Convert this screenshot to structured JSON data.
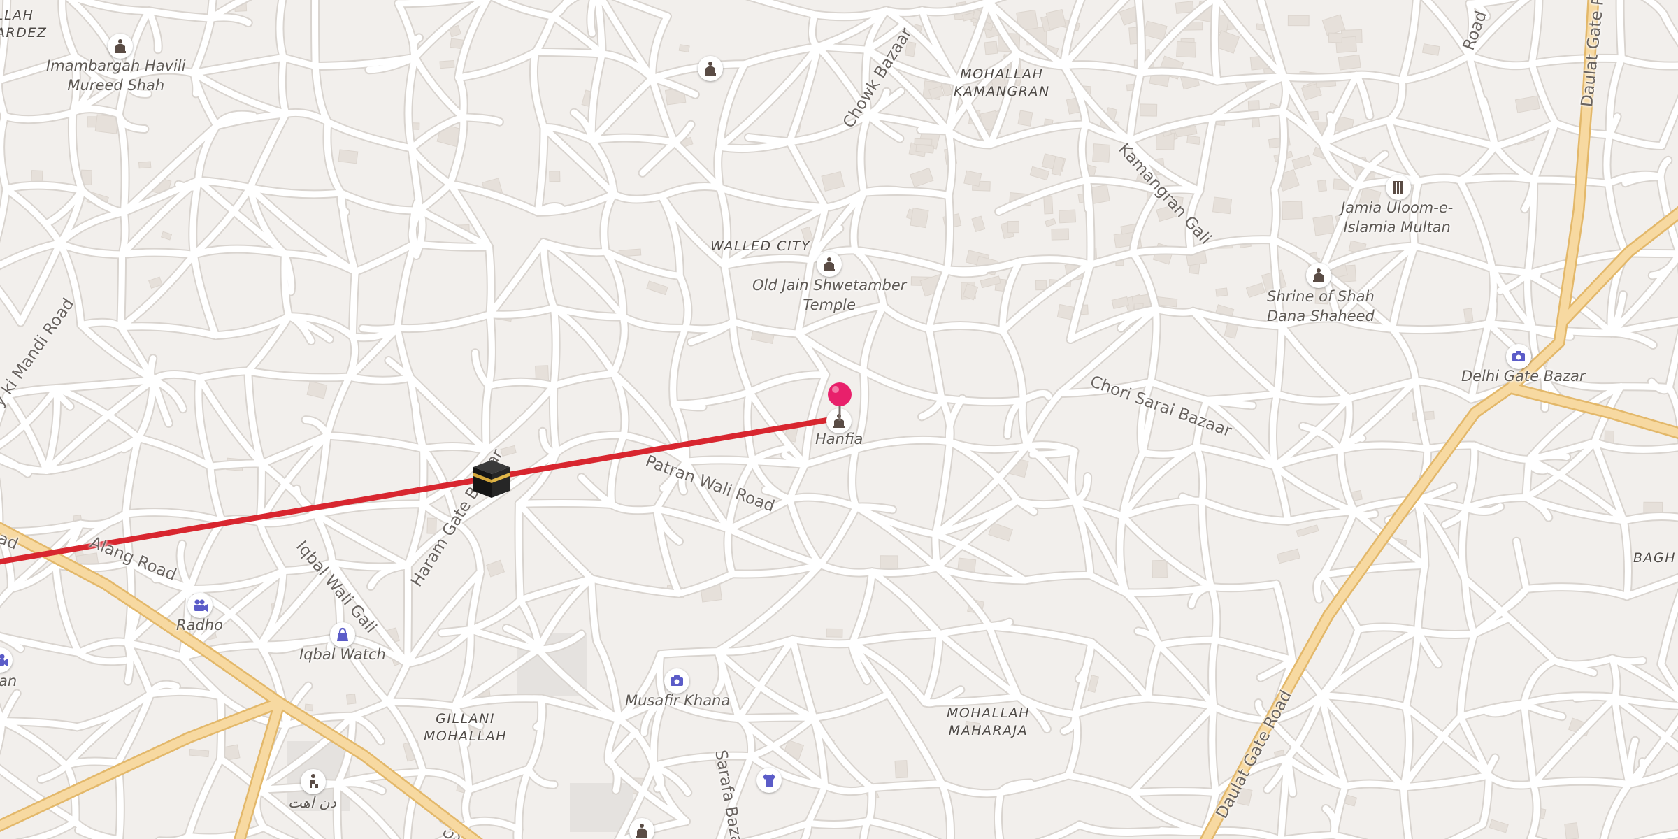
{
  "colors": {
    "land": "#f2efec",
    "street": "#ffffff",
    "street_casing": "#d9d4cf",
    "major_road": "#f7d9a1",
    "major_road_casing": "#e3b86a",
    "building": "#e6e0da",
    "route_line": "#d8262f",
    "pin": "#e8206b",
    "worship_icon": "#5a4c45",
    "service_icon": "#5b5cc8"
  },
  "areas": {
    "walled_city": "WALLED CITY",
    "mohallah_kamangran": "MOHALLAH\nKAMANGRAN",
    "gillani_mohallah": "GILLANI\nMOHALLAH",
    "mohallah_maharaja": "MOHALLAH\nMAHARAJA",
    "bagh": "BAGH",
    "top_left": "LLAH\nARDEZ"
  },
  "roads": {
    "chowk_bazaar": "Chowk Bazaar",
    "kamangran_gali": "Kamangran Gali",
    "chori_sarai_bazaar": "Chori Sarai Bazaar",
    "patran_wali_road": "Patran Wali Road",
    "haram_gate_bazaar": "Haram Gate Bazaar",
    "iqbal_wali_gali": "Iqbal Wali Gali",
    "alang_road": "Alang Road",
    "mandi_road": "y ki Mandi Road",
    "daulat_gate_road_top": "Daulat Gate Road",
    "daulat_gate_road_bottom": "Daulat Gate Road",
    "sarafa_bazaar": "Sarafa Bazaar",
    "road_fragment_left": "ad",
    "road_fragment_top_right": "Road",
    "road_fragment_bottom": "دن"
  },
  "places": {
    "imambargah": "Imambargah Havili\nMureed Shah",
    "old_jain_temple": "Old Jain Shwetamber\nTemple",
    "jamia_uloom": "Jamia Uloom-e-\nIslamia Multan",
    "shrine_shah_dana": "Shrine of Shah\nDana Shaheed",
    "delhi_gate_bazar": "Delhi Gate Bazar",
    "hanfia": "Hanfia",
    "radho": "Radho",
    "iqbal_watch": "Iqbal Watch",
    "musafir_khana": "Musafir Khana",
    "an_fragment": "an",
    "urdu_label": "دن اهت"
  },
  "icons": {
    "imambargah": "place-of-worship-icon",
    "top_worship": "place-of-worship-icon",
    "old_jain_temple": "place-of-worship-icon",
    "hanfia": "place-of-worship-icon",
    "shrine_shah_dana": "place-of-worship-icon",
    "jamia_uloom": "school-icon",
    "delhi_gate_bazar": "camera-icon",
    "musafir_khana": "camera-icon",
    "radho": "cinema-icon",
    "iqbal_watch": "shopping-bag-icon",
    "clothing": "clothes-icon",
    "bottom_left": "sports-icon",
    "bottom_worship": "place-of-worship-icon",
    "left_edge": "cinema-icon",
    "qibla": "kaaba-icon",
    "pin": "location-pin-icon"
  }
}
